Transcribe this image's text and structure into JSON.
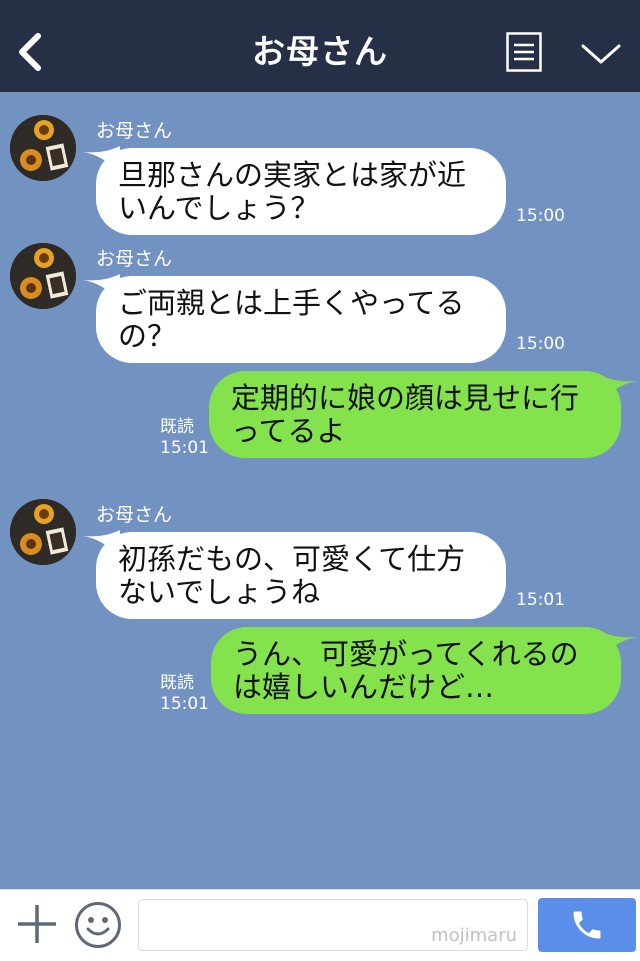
{
  "header": {
    "title": "お母さん"
  },
  "messages": [
    {
      "side": "in",
      "sender": "お母さん",
      "text": "旦那さんの実家とは家が近\nいんでしょう？",
      "time": "15:00"
    },
    {
      "side": "in",
      "sender": "お母さん",
      "text": "ご両親とは上手くやってる\nの？",
      "time": "15:00"
    },
    {
      "side": "out",
      "read": "既読",
      "time": "15:01",
      "text": "定期的に娘の顔は見せに行\nってるよ"
    },
    {
      "side": "in",
      "sender": "お母さん",
      "text": "初孫だもの、可愛くて仕方\nないでしょうね",
      "time": "15:01"
    },
    {
      "side": "out",
      "read": "既読",
      "time": "15:01",
      "text": "うん、可愛がってくれるの\nは嬉しいんだけど…"
    }
  ],
  "footer": {
    "input_value": "",
    "watermark": "mojimaru"
  },
  "colors": {
    "header": "#253047",
    "background": "#7292c1",
    "bubble_in": "#ffffff",
    "bubble_out": "#84e24d",
    "call_button": "#5b8ee8"
  },
  "icons": [
    "back-icon",
    "menu-icon",
    "chevron-down-icon",
    "plus-icon",
    "smile-icon",
    "phone-icon"
  ]
}
